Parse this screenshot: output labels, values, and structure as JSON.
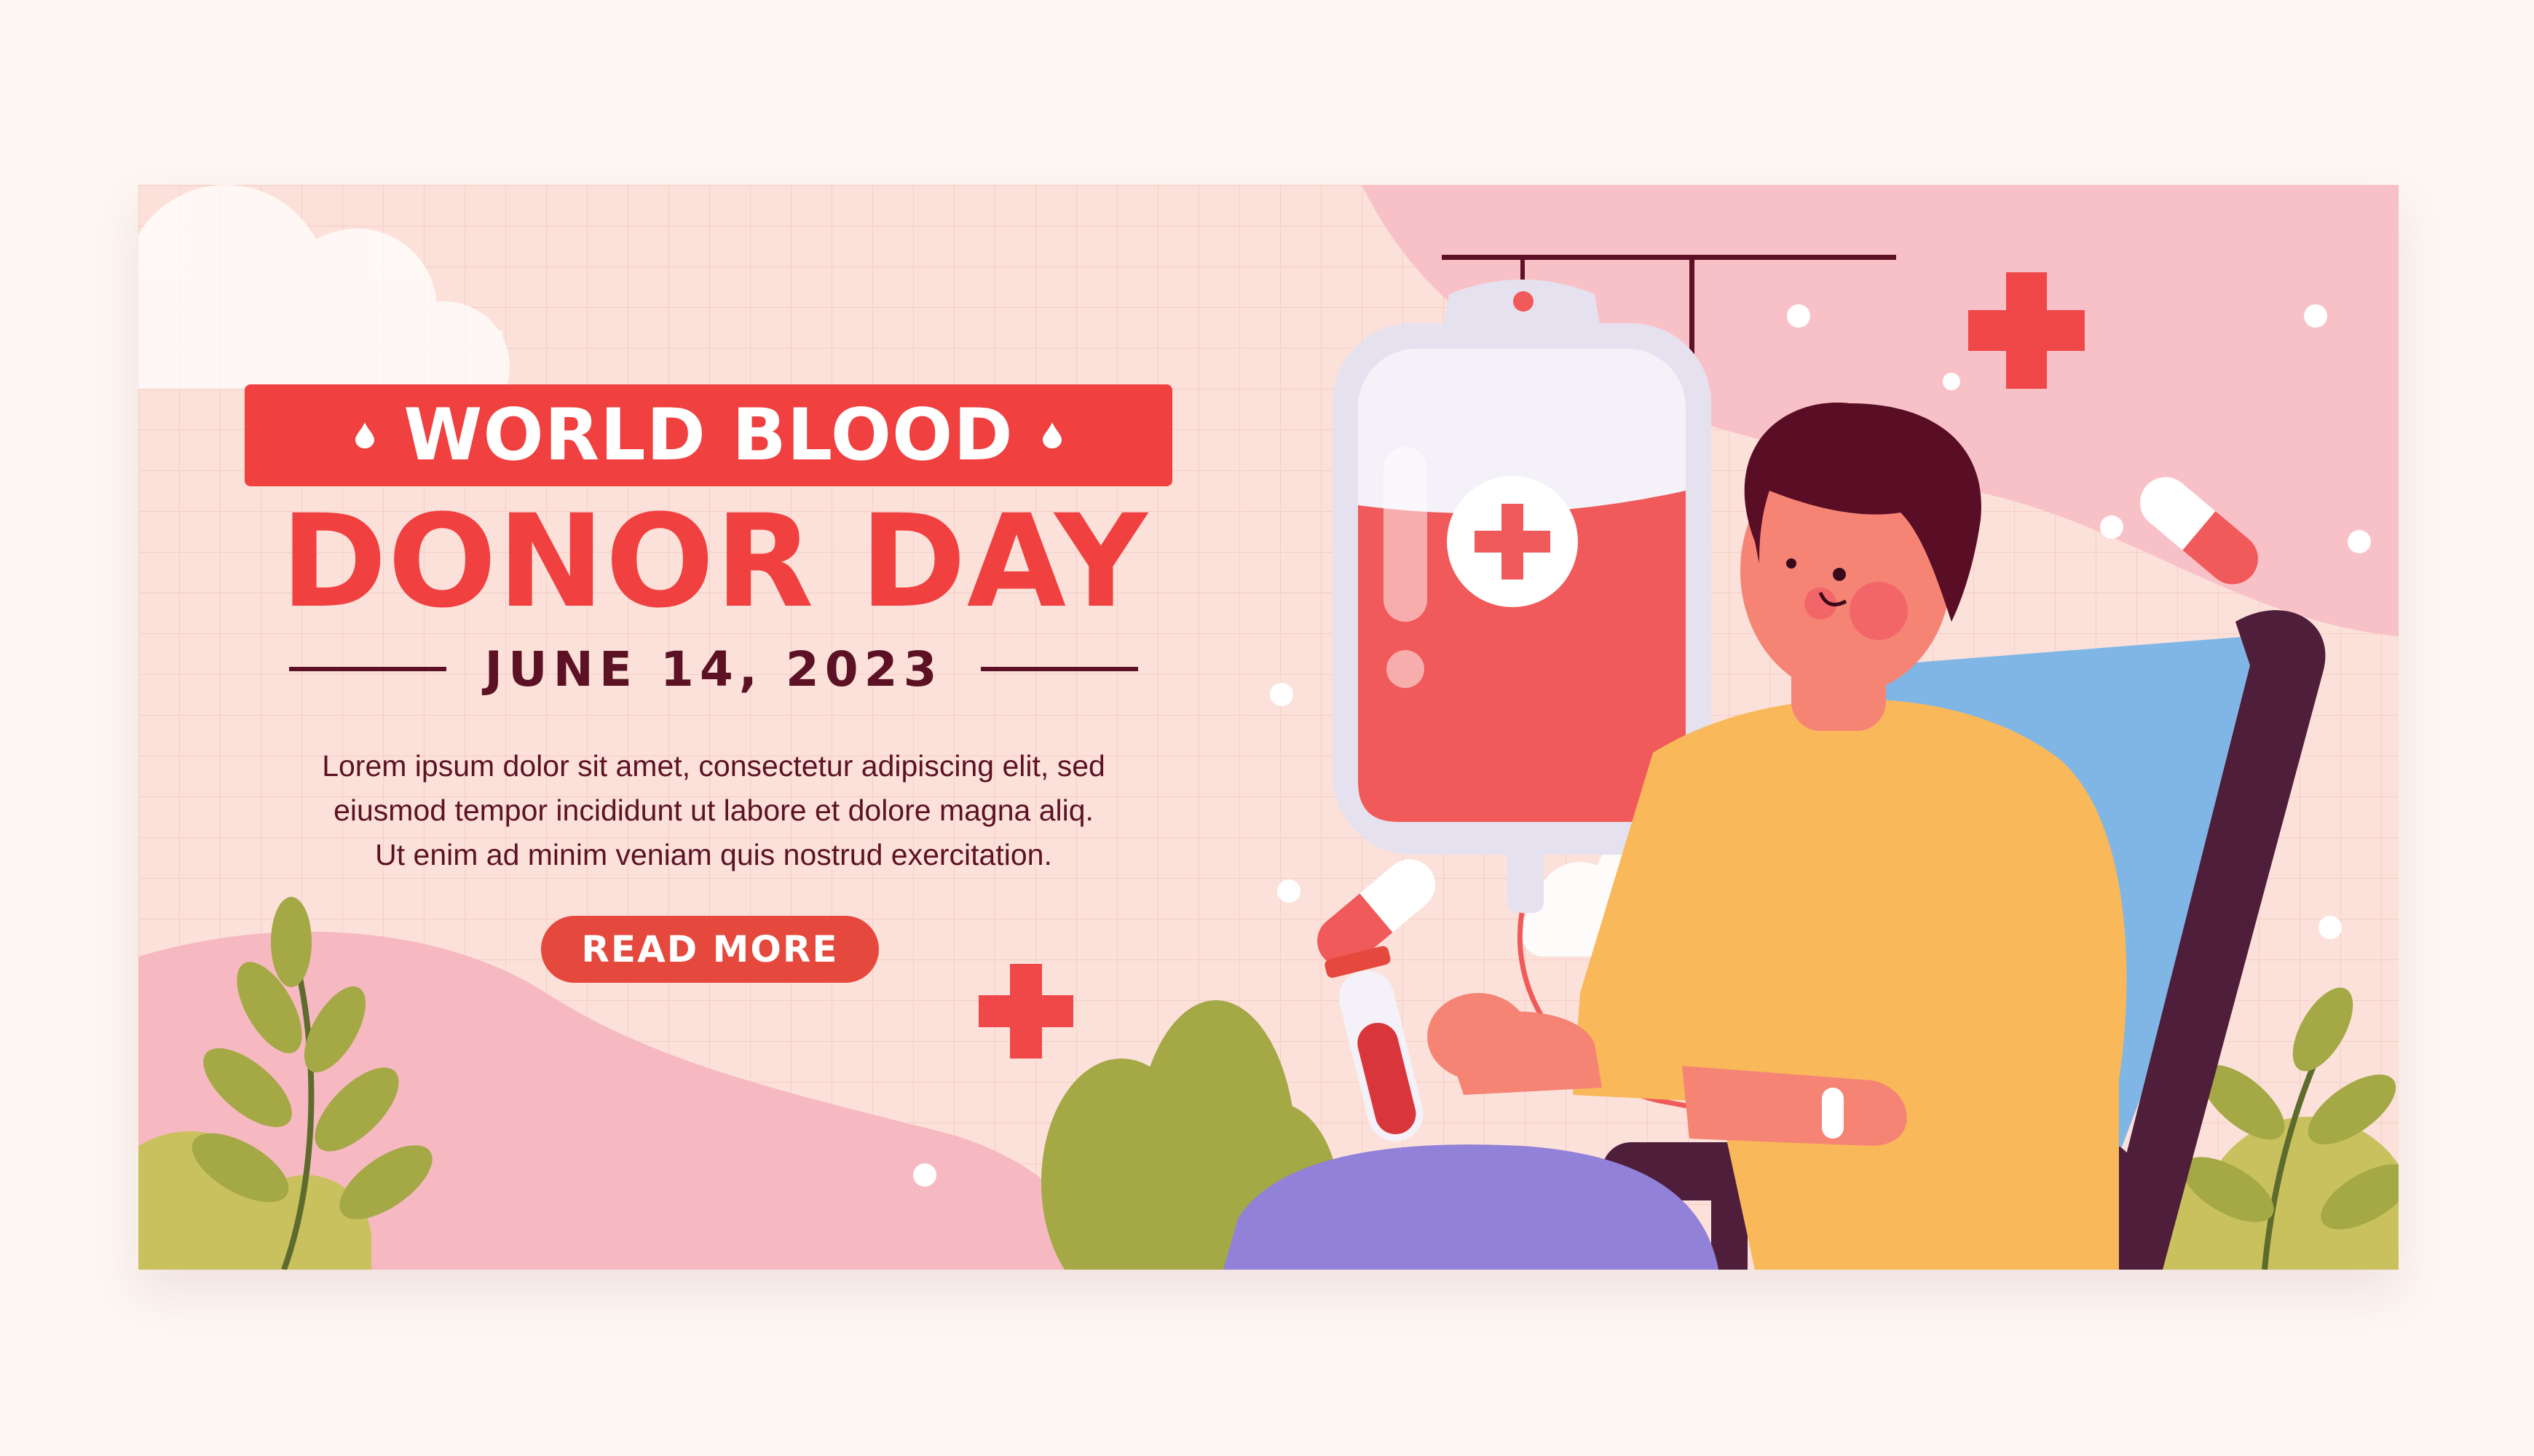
{
  "banner": {
    "title_line1": "WORLD BLOOD",
    "title_line2": "DONOR DAY",
    "date": "JUNE 14, 2023",
    "body_lines": [
      "Lorem ipsum dolor sit amet, consectetur adipiscing elit, sed",
      "eiusmod tempor incididunt ut labore et dolore magna aliq.",
      "Ut enim ad minim veniam quis nostrud exercitation."
    ],
    "cta_label": "READ MORE"
  },
  "colors": {
    "background": "#fbe1da",
    "accent_red": "#f04040",
    "dark_text": "#5c1224",
    "button": "#e5483c",
    "shirt": "#f9b85a",
    "pants": "#9181d8",
    "chair_frame": "#4e1e3a",
    "chair_back": "#7fb6e6",
    "leaf_green": "#a4a845"
  },
  "icons": [
    "blood-drop-icon",
    "medical-cross-icon",
    "capsule-pill-icon"
  ]
}
